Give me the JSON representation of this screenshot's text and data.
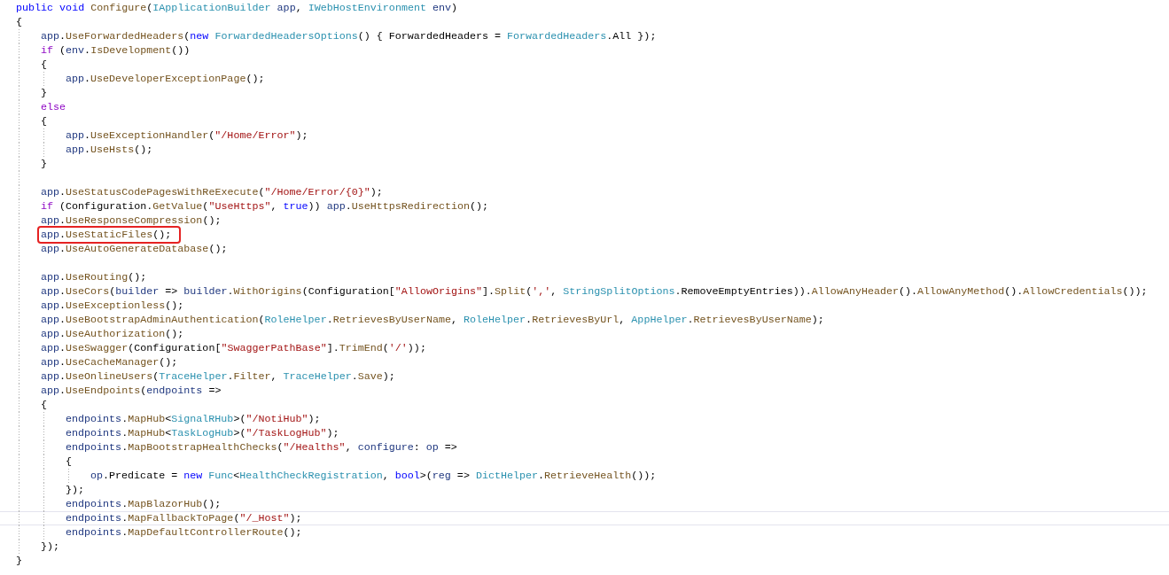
{
  "code": [
    {
      "kind": "line",
      "highlighted": false,
      "current": false,
      "tokens": [
        {
          "text": "public ",
          "kind": "keyword"
        },
        {
          "text": "void ",
          "kind": "keyword"
        },
        {
          "text": "Configure",
          "kind": "method"
        },
        {
          "text": "(",
          "kind": "plain"
        },
        {
          "text": "IApplicationBuilder ",
          "kind": "type"
        },
        {
          "text": "app",
          "kind": "variable"
        },
        {
          "text": ", ",
          "kind": "plain"
        },
        {
          "text": "IWebHostEnvironment ",
          "kind": "type"
        },
        {
          "text": "env",
          "kind": "variable"
        },
        {
          "text": ")",
          "kind": "plain"
        }
      ]
    },
    {
      "kind": "line",
      "highlighted": false,
      "current": false,
      "tokens": [
        {
          "text": "{",
          "kind": "plain"
        }
      ]
    },
    {
      "kind": "block",
      "children": [
        {
          "kind": "line",
          "highlighted": false,
          "current": false,
          "tokens": [
            {
              "text": "app",
              "kind": "variable"
            },
            {
              "text": ".",
              "kind": "plain"
            },
            {
              "text": "UseForwardedHeaders",
              "kind": "method"
            },
            {
              "text": "(",
              "kind": "plain"
            },
            {
              "text": "new ",
              "kind": "keyword"
            },
            {
              "text": "ForwardedHeadersOptions",
              "kind": "type"
            },
            {
              "text": "() { ForwardedHeaders = ",
              "kind": "plain"
            },
            {
              "text": "ForwardedHeaders",
              "kind": "type"
            },
            {
              "text": ".All });",
              "kind": "plain"
            }
          ]
        },
        {
          "kind": "line",
          "highlighted": false,
          "current": false,
          "tokens": [
            {
              "text": "if",
              "kind": "control"
            },
            {
              "text": " (",
              "kind": "plain"
            },
            {
              "text": "env",
              "kind": "variable"
            },
            {
              "text": ".",
              "kind": "plain"
            },
            {
              "text": "IsDevelopment",
              "kind": "method"
            },
            {
              "text": "())",
              "kind": "plain"
            }
          ]
        },
        {
          "kind": "line",
          "highlighted": false,
          "current": false,
          "tokens": [
            {
              "text": "{",
              "kind": "plain"
            }
          ]
        },
        {
          "kind": "block",
          "children": [
            {
              "kind": "line",
              "highlighted": false,
              "current": false,
              "tokens": [
                {
                  "text": "app",
                  "kind": "variable"
                },
                {
                  "text": ".",
                  "kind": "plain"
                },
                {
                  "text": "UseDeveloperExceptionPage",
                  "kind": "method"
                },
                {
                  "text": "();",
                  "kind": "plain"
                }
              ]
            }
          ]
        },
        {
          "kind": "line",
          "highlighted": false,
          "current": false,
          "tokens": [
            {
              "text": "}",
              "kind": "plain"
            }
          ]
        },
        {
          "kind": "line",
          "highlighted": false,
          "current": false,
          "tokens": [
            {
              "text": "else",
              "kind": "control"
            }
          ]
        },
        {
          "kind": "line",
          "highlighted": false,
          "current": false,
          "tokens": [
            {
              "text": "{",
              "kind": "plain"
            }
          ]
        },
        {
          "kind": "block",
          "children": [
            {
              "kind": "line",
              "highlighted": false,
              "current": false,
              "tokens": [
                {
                  "text": "app",
                  "kind": "variable"
                },
                {
                  "text": ".",
                  "kind": "plain"
                },
                {
                  "text": "UseExceptionHandler",
                  "kind": "method"
                },
                {
                  "text": "(",
                  "kind": "plain"
                },
                {
                  "text": "\"/Home/Error\"",
                  "kind": "string"
                },
                {
                  "text": ");",
                  "kind": "plain"
                }
              ]
            },
            {
              "kind": "line",
              "highlighted": false,
              "current": false,
              "tokens": [
                {
                  "text": "app",
                  "kind": "variable"
                },
                {
                  "text": ".",
                  "kind": "plain"
                },
                {
                  "text": "UseHsts",
                  "kind": "method"
                },
                {
                  "text": "();",
                  "kind": "plain"
                }
              ]
            }
          ]
        },
        {
          "kind": "line",
          "highlighted": false,
          "current": false,
          "tokens": [
            {
              "text": "}",
              "kind": "plain"
            }
          ]
        },
        {
          "kind": "blank"
        },
        {
          "kind": "line",
          "highlighted": false,
          "current": false,
          "tokens": [
            {
              "text": "app",
              "kind": "variable"
            },
            {
              "text": ".",
              "kind": "plain"
            },
            {
              "text": "UseStatusCodePagesWithReExecute",
              "kind": "method"
            },
            {
              "text": "(",
              "kind": "plain"
            },
            {
              "text": "\"/Home/Error/{0}\"",
              "kind": "string"
            },
            {
              "text": ");",
              "kind": "plain"
            }
          ]
        },
        {
          "kind": "line",
          "highlighted": false,
          "current": false,
          "tokens": [
            {
              "text": "if",
              "kind": "control"
            },
            {
              "text": " (Configuration.",
              "kind": "plain"
            },
            {
              "text": "GetValue",
              "kind": "method"
            },
            {
              "text": "(",
              "kind": "plain"
            },
            {
              "text": "\"UseHttps\"",
              "kind": "string"
            },
            {
              "text": ", ",
              "kind": "plain"
            },
            {
              "text": "true",
              "kind": "keyword"
            },
            {
              "text": ")) ",
              "kind": "plain"
            },
            {
              "text": "app",
              "kind": "variable"
            },
            {
              "text": ".",
              "kind": "plain"
            },
            {
              "text": "UseHttpsRedirection",
              "kind": "method"
            },
            {
              "text": "();",
              "kind": "plain"
            }
          ]
        },
        {
          "kind": "line",
          "highlighted": false,
          "current": false,
          "tokens": [
            {
              "text": "app",
              "kind": "variable"
            },
            {
              "text": ".",
              "kind": "plain"
            },
            {
              "text": "UseResponseCompression",
              "kind": "method"
            },
            {
              "text": "();",
              "kind": "plain"
            }
          ]
        },
        {
          "kind": "line",
          "highlighted": true,
          "current": false,
          "tokens": [
            {
              "text": "app",
              "kind": "variable"
            },
            {
              "text": ".",
              "kind": "plain"
            },
            {
              "text": "UseStaticFiles",
              "kind": "method"
            },
            {
              "text": "();",
              "kind": "plain"
            }
          ]
        },
        {
          "kind": "line",
          "highlighted": false,
          "current": false,
          "tokens": [
            {
              "text": "app",
              "kind": "variable"
            },
            {
              "text": ".",
              "kind": "plain"
            },
            {
              "text": "UseAutoGenerateDatabase",
              "kind": "method"
            },
            {
              "text": "();",
              "kind": "plain"
            }
          ]
        },
        {
          "kind": "blank"
        },
        {
          "kind": "line",
          "highlighted": false,
          "current": false,
          "tokens": [
            {
              "text": "app",
              "kind": "variable"
            },
            {
              "text": ".",
              "kind": "plain"
            },
            {
              "text": "UseRouting",
              "kind": "method"
            },
            {
              "text": "();",
              "kind": "plain"
            }
          ]
        },
        {
          "kind": "line",
          "highlighted": false,
          "current": false,
          "tokens": [
            {
              "text": "app",
              "kind": "variable"
            },
            {
              "text": ".",
              "kind": "plain"
            },
            {
              "text": "UseCors",
              "kind": "method"
            },
            {
              "text": "(",
              "kind": "plain"
            },
            {
              "text": "builder",
              "kind": "variable"
            },
            {
              "text": " => ",
              "kind": "plain"
            },
            {
              "text": "builder",
              "kind": "variable"
            },
            {
              "text": ".",
              "kind": "plain"
            },
            {
              "text": "WithOrigins",
              "kind": "method"
            },
            {
              "text": "(Configuration[",
              "kind": "plain"
            },
            {
              "text": "\"AllowOrigins\"",
              "kind": "string"
            },
            {
              "text": "].",
              "kind": "plain"
            },
            {
              "text": "Split",
              "kind": "method"
            },
            {
              "text": "(",
              "kind": "plain"
            },
            {
              "text": "','",
              "kind": "string"
            },
            {
              "text": ", ",
              "kind": "plain"
            },
            {
              "text": "StringSplitOptions",
              "kind": "type"
            },
            {
              "text": ".RemoveEmptyEntries)).",
              "kind": "plain"
            },
            {
              "text": "AllowAnyHeader",
              "kind": "method"
            },
            {
              "text": "().",
              "kind": "plain"
            },
            {
              "text": "AllowAnyMethod",
              "kind": "method"
            },
            {
              "text": "().",
              "kind": "plain"
            },
            {
              "text": "AllowCredentials",
              "kind": "method"
            },
            {
              "text": "());",
              "kind": "plain"
            }
          ]
        },
        {
          "kind": "line",
          "highlighted": false,
          "current": false,
          "tokens": [
            {
              "text": "app",
              "kind": "variable"
            },
            {
              "text": ".",
              "kind": "plain"
            },
            {
              "text": "UseExceptionless",
              "kind": "method"
            },
            {
              "text": "();",
              "kind": "plain"
            }
          ]
        },
        {
          "kind": "line",
          "highlighted": false,
          "current": false,
          "tokens": [
            {
              "text": "app",
              "kind": "variable"
            },
            {
              "text": ".",
              "kind": "plain"
            },
            {
              "text": "UseBootstrapAdminAuthentication",
              "kind": "method"
            },
            {
              "text": "(",
              "kind": "plain"
            },
            {
              "text": "RoleHelper",
              "kind": "type"
            },
            {
              "text": ".",
              "kind": "plain"
            },
            {
              "text": "RetrievesByUserName",
              "kind": "method"
            },
            {
              "text": ", ",
              "kind": "plain"
            },
            {
              "text": "RoleHelper",
              "kind": "type"
            },
            {
              "text": ".",
              "kind": "plain"
            },
            {
              "text": "RetrievesByUrl",
              "kind": "method"
            },
            {
              "text": ", ",
              "kind": "plain"
            },
            {
              "text": "AppHelper",
              "kind": "type"
            },
            {
              "text": ".",
              "kind": "plain"
            },
            {
              "text": "RetrievesByUserName",
              "kind": "method"
            },
            {
              "text": ");",
              "kind": "plain"
            }
          ]
        },
        {
          "kind": "line",
          "highlighted": false,
          "current": false,
          "tokens": [
            {
              "text": "app",
              "kind": "variable"
            },
            {
              "text": ".",
              "kind": "plain"
            },
            {
              "text": "UseAuthorization",
              "kind": "method"
            },
            {
              "text": "();",
              "kind": "plain"
            }
          ]
        },
        {
          "kind": "line",
          "highlighted": false,
          "current": false,
          "tokens": [
            {
              "text": "app",
              "kind": "variable"
            },
            {
              "text": ".",
              "kind": "plain"
            },
            {
              "text": "UseSwagger",
              "kind": "method"
            },
            {
              "text": "(Configuration[",
              "kind": "plain"
            },
            {
              "text": "\"SwaggerPathBase\"",
              "kind": "string"
            },
            {
              "text": "].",
              "kind": "plain"
            },
            {
              "text": "TrimEnd",
              "kind": "method"
            },
            {
              "text": "(",
              "kind": "plain"
            },
            {
              "text": "'/'",
              "kind": "string"
            },
            {
              "text": "));",
              "kind": "plain"
            }
          ]
        },
        {
          "kind": "line",
          "highlighted": false,
          "current": false,
          "tokens": [
            {
              "text": "app",
              "kind": "variable"
            },
            {
              "text": ".",
              "kind": "plain"
            },
            {
              "text": "UseCacheManager",
              "kind": "method"
            },
            {
              "text": "();",
              "kind": "plain"
            }
          ]
        },
        {
          "kind": "line",
          "highlighted": false,
          "current": false,
          "tokens": [
            {
              "text": "app",
              "kind": "variable"
            },
            {
              "text": ".",
              "kind": "plain"
            },
            {
              "text": "UseOnlineUsers",
              "kind": "method"
            },
            {
              "text": "(",
              "kind": "plain"
            },
            {
              "text": "TraceHelper",
              "kind": "type"
            },
            {
              "text": ".",
              "kind": "plain"
            },
            {
              "text": "Filter",
              "kind": "method"
            },
            {
              "text": ", ",
              "kind": "plain"
            },
            {
              "text": "TraceHelper",
              "kind": "type"
            },
            {
              "text": ".",
              "kind": "plain"
            },
            {
              "text": "Save",
              "kind": "method"
            },
            {
              "text": ");",
              "kind": "plain"
            }
          ]
        },
        {
          "kind": "line",
          "highlighted": false,
          "current": false,
          "tokens": [
            {
              "text": "app",
              "kind": "variable"
            },
            {
              "text": ".",
              "kind": "plain"
            },
            {
              "text": "UseEndpoints",
              "kind": "method"
            },
            {
              "text": "(",
              "kind": "plain"
            },
            {
              "text": "endpoints",
              "kind": "variable"
            },
            {
              "text": " =>",
              "kind": "plain"
            }
          ]
        },
        {
          "kind": "line",
          "highlighted": false,
          "current": false,
          "tokens": [
            {
              "text": "{",
              "kind": "plain"
            }
          ]
        },
        {
          "kind": "block",
          "children": [
            {
              "kind": "line",
              "highlighted": false,
              "current": false,
              "tokens": [
                {
                  "text": "endpoints",
                  "kind": "variable"
                },
                {
                  "text": ".",
                  "kind": "plain"
                },
                {
                  "text": "MapHub",
                  "kind": "method"
                },
                {
                  "text": "<",
                  "kind": "plain"
                },
                {
                  "text": "SignalRHub",
                  "kind": "type"
                },
                {
                  "text": ">(",
                  "kind": "plain"
                },
                {
                  "text": "\"/NotiHub\"",
                  "kind": "string"
                },
                {
                  "text": ");",
                  "kind": "plain"
                }
              ]
            },
            {
              "kind": "line",
              "highlighted": false,
              "current": false,
              "tokens": [
                {
                  "text": "endpoints",
                  "kind": "variable"
                },
                {
                  "text": ".",
                  "kind": "plain"
                },
                {
                  "text": "MapHub",
                  "kind": "method"
                },
                {
                  "text": "<",
                  "kind": "plain"
                },
                {
                  "text": "TaskLogHub",
                  "kind": "type"
                },
                {
                  "text": ">(",
                  "kind": "plain"
                },
                {
                  "text": "\"/TaskLogHub\"",
                  "kind": "string"
                },
                {
                  "text": ");",
                  "kind": "plain"
                }
              ]
            },
            {
              "kind": "line",
              "highlighted": false,
              "current": false,
              "tokens": [
                {
                  "text": "endpoints",
                  "kind": "variable"
                },
                {
                  "text": ".",
                  "kind": "plain"
                },
                {
                  "text": "MapBootstrapHealthChecks",
                  "kind": "method"
                },
                {
                  "text": "(",
                  "kind": "plain"
                },
                {
                  "text": "\"/Healths\"",
                  "kind": "string"
                },
                {
                  "text": ", ",
                  "kind": "plain"
                },
                {
                  "text": "configure",
                  "kind": "variable"
                },
                {
                  "text": ": ",
                  "kind": "plain"
                },
                {
                  "text": "op",
                  "kind": "variable"
                },
                {
                  "text": " =>",
                  "kind": "plain"
                }
              ]
            },
            {
              "kind": "line",
              "highlighted": false,
              "current": false,
              "tokens": [
                {
                  "text": "{",
                  "kind": "plain"
                }
              ]
            },
            {
              "kind": "block",
              "children": [
                {
                  "kind": "line",
                  "highlighted": false,
                  "current": false,
                  "tokens": [
                    {
                      "text": "op",
                      "kind": "variable"
                    },
                    {
                      "text": ".Predicate = ",
                      "kind": "plain"
                    },
                    {
                      "text": "new ",
                      "kind": "keyword"
                    },
                    {
                      "text": "Func",
                      "kind": "type"
                    },
                    {
                      "text": "<",
                      "kind": "plain"
                    },
                    {
                      "text": "HealthCheckRegistration",
                      "kind": "type"
                    },
                    {
                      "text": ", ",
                      "kind": "plain"
                    },
                    {
                      "text": "bool",
                      "kind": "keyword"
                    },
                    {
                      "text": ">(",
                      "kind": "plain"
                    },
                    {
                      "text": "reg",
                      "kind": "variable"
                    },
                    {
                      "text": " => ",
                      "kind": "plain"
                    },
                    {
                      "text": "DictHelper",
                      "kind": "type"
                    },
                    {
                      "text": ".",
                      "kind": "plain"
                    },
                    {
                      "text": "RetrieveHealth",
                      "kind": "method"
                    },
                    {
                      "text": "());",
                      "kind": "plain"
                    }
                  ]
                }
              ]
            },
            {
              "kind": "line",
              "highlighted": false,
              "current": false,
              "tokens": [
                {
                  "text": "});",
                  "kind": "plain"
                }
              ]
            },
            {
              "kind": "line",
              "highlighted": false,
              "current": false,
              "tokens": [
                {
                  "text": "endpoints",
                  "kind": "variable"
                },
                {
                  "text": ".",
                  "kind": "plain"
                },
                {
                  "text": "MapBlazorHub",
                  "kind": "method"
                },
                {
                  "text": "();",
                  "kind": "plain"
                }
              ]
            },
            {
              "kind": "line",
              "highlighted": false,
              "current": true,
              "tokens": [
                {
                  "text": "endpoints",
                  "kind": "variable"
                },
                {
                  "text": ".",
                  "kind": "plain"
                },
                {
                  "text": "MapFallbackToPage",
                  "kind": "method"
                },
                {
                  "text": "(",
                  "kind": "plain"
                },
                {
                  "text": "\"/_Host\"",
                  "kind": "string"
                },
                {
                  "text": ");",
                  "kind": "plain"
                }
              ]
            },
            {
              "kind": "line",
              "highlighted": false,
              "current": false,
              "tokens": [
                {
                  "text": "endpoints",
                  "kind": "variable"
                },
                {
                  "text": ".",
                  "kind": "plain"
                },
                {
                  "text": "MapDefaultControllerRoute",
                  "kind": "method"
                },
                {
                  "text": "();",
                  "kind": "plain"
                }
              ]
            }
          ]
        },
        {
          "kind": "line",
          "highlighted": false,
          "current": false,
          "tokens": [
            {
              "text": "});",
              "kind": "plain"
            }
          ]
        }
      ]
    },
    {
      "kind": "line",
      "highlighted": false,
      "current": false,
      "tokens": [
        {
          "text": "}",
          "kind": "plain"
        }
      ]
    }
  ]
}
